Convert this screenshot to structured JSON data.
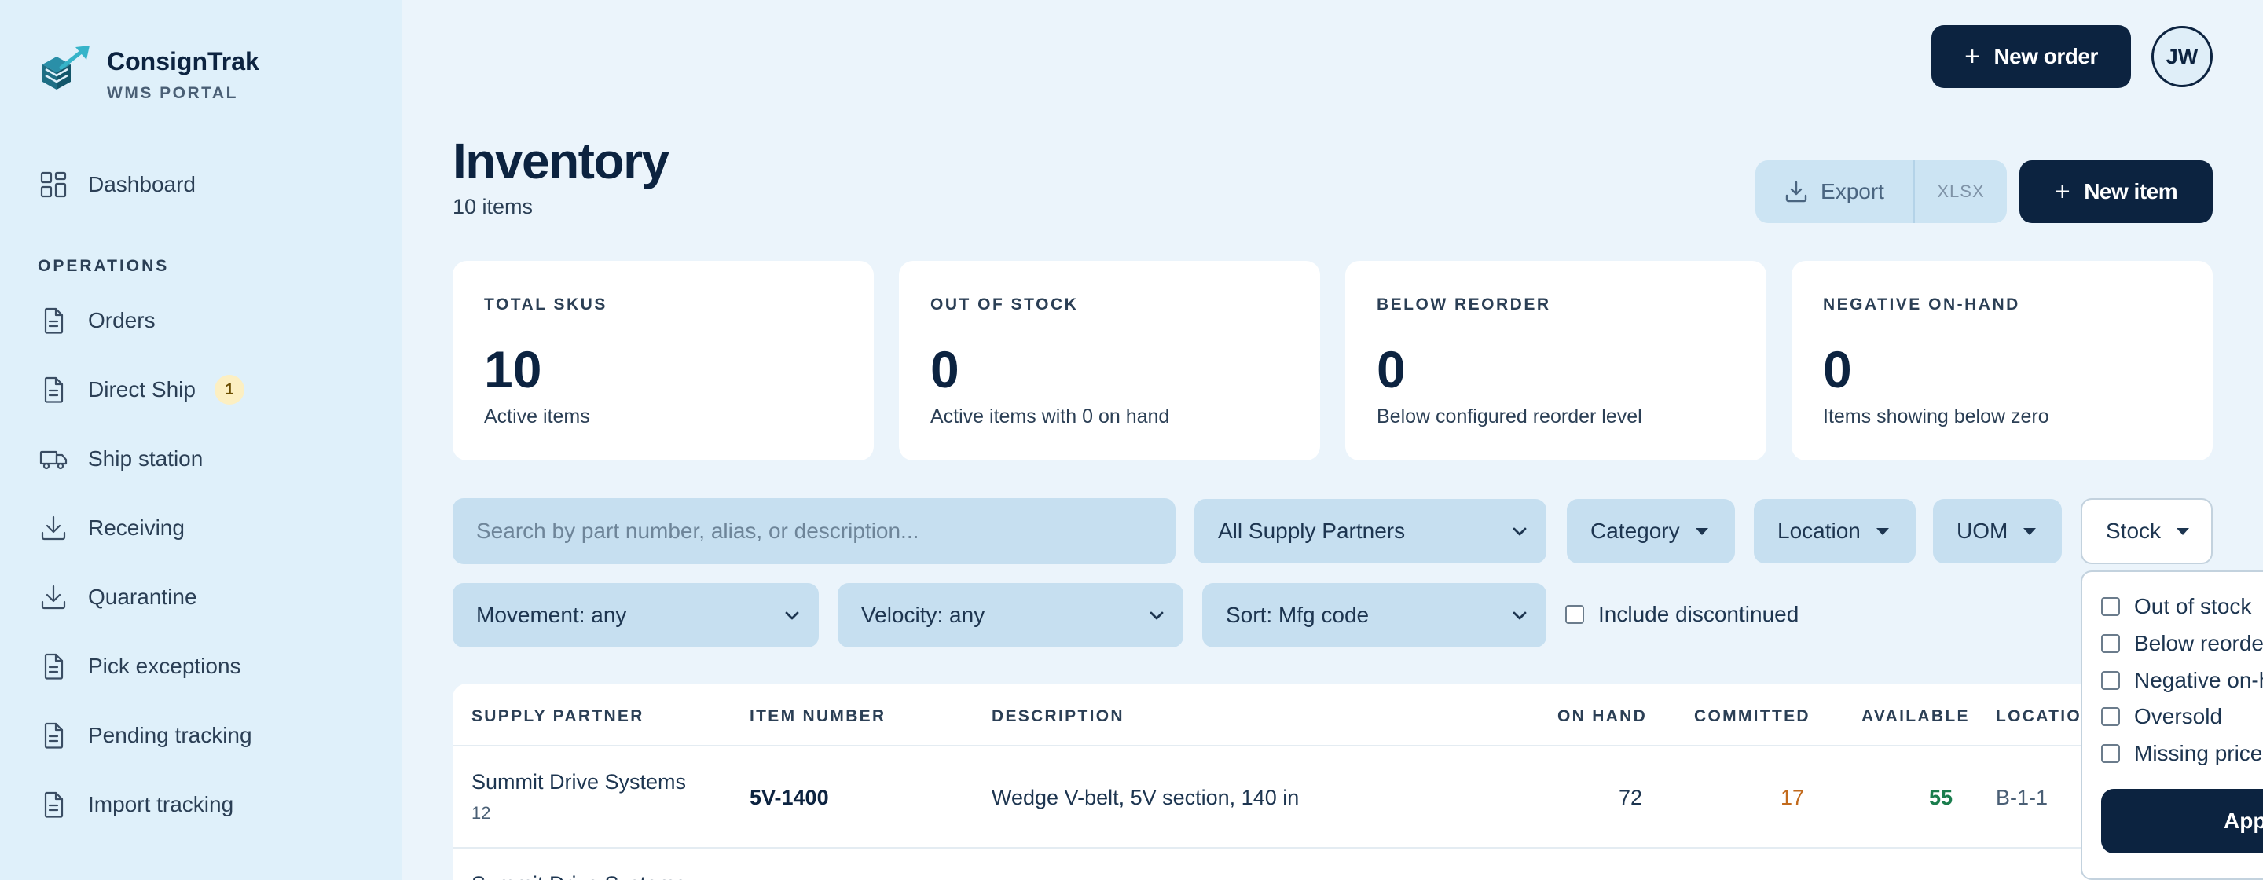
{
  "brand": {
    "name": "ConsignTrak",
    "subtitle": "WMS PORTAL"
  },
  "sidebar": {
    "top_item": {
      "label": "Dashboard",
      "icon": "grid-icon"
    },
    "section_label": "OPERATIONS",
    "items": [
      {
        "label": "Orders",
        "icon": "document-icon"
      },
      {
        "label": "Direct Ship",
        "icon": "document-icon",
        "badge": "1"
      },
      {
        "label": "Ship station",
        "icon": "truck-icon"
      },
      {
        "label": "Receiving",
        "icon": "download-icon"
      },
      {
        "label": "Quarantine",
        "icon": "download-icon"
      },
      {
        "label": "Pick exceptions",
        "icon": "document-icon"
      },
      {
        "label": "Pending tracking",
        "icon": "document-icon"
      },
      {
        "label": "Import tracking",
        "icon": "document-icon"
      }
    ]
  },
  "header": {
    "new_order_label": "New order",
    "avatar_initials": "JW"
  },
  "page": {
    "title": "Inventory",
    "subtitle": "10 items",
    "export_label": "Export",
    "export_format": "XLSX",
    "new_item_label": "New item"
  },
  "kpis": [
    {
      "label": "TOTAL SKUS",
      "value": "10",
      "desc": "Active items"
    },
    {
      "label": "OUT OF STOCK",
      "value": "0",
      "desc": "Active items with 0 on hand"
    },
    {
      "label": "BELOW REORDER",
      "value": "0",
      "desc": "Below configured reorder level"
    },
    {
      "label": "NEGATIVE ON-HAND",
      "value": "0",
      "desc": "Items showing below zero"
    }
  ],
  "filters": {
    "search_placeholder": "Search by part number, alias, or description...",
    "supply_partner": "All Supply Partners",
    "category": "Category",
    "location": "Location",
    "uom": "UOM",
    "stock": "Stock",
    "movement": "Movement: any",
    "velocity": "Velocity: any",
    "sort": "Sort: Mfg code",
    "include_discontinued": "Include discontinued"
  },
  "stock_dropdown": {
    "options": [
      "Out of stock",
      "Below reorder",
      "Negative on-hand",
      "Oversold",
      "Missing price"
    ],
    "apply_label": "Apply"
  },
  "table": {
    "columns": [
      "SUPPLY PARTNER",
      "ITEM NUMBER",
      "DESCRIPTION",
      "ON HAND",
      "COMMITTED",
      "AVAILABLE",
      "LOCATION"
    ],
    "rows": [
      {
        "supply_partner": "Summit Drive Systems",
        "partner_sub": "12",
        "item_number": "5V-1400",
        "description": "Wedge V-belt, 5V section, 140 in",
        "on_hand": "72",
        "committed": "17",
        "available": "55",
        "location": "B-1-1"
      },
      {
        "supply_partner": "Summit Drive Systems"
      }
    ]
  },
  "colors": {
    "brand_navy": "#0c2340",
    "committed_orange": "#c26a1c",
    "available_green": "#1a7d4d",
    "badge_yellow": "#fcefc2"
  }
}
